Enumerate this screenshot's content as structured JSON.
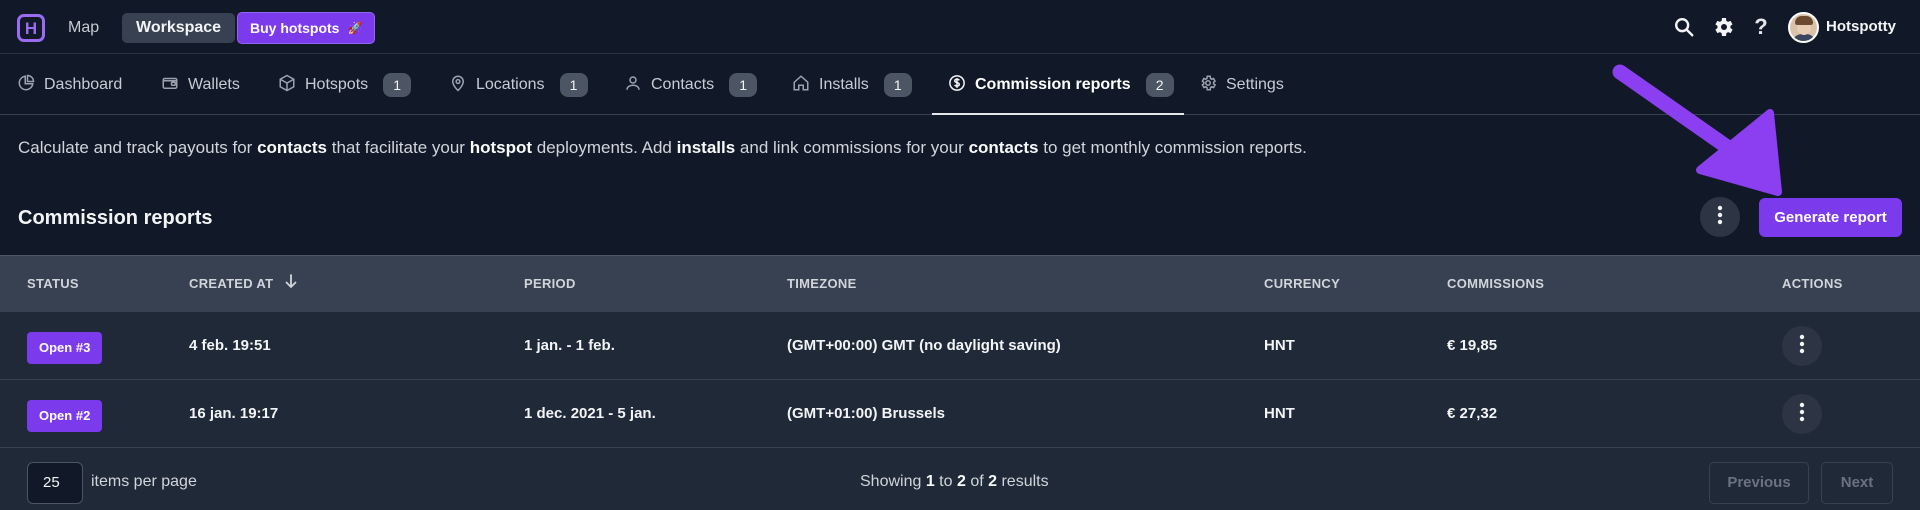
{
  "topbar": {
    "logo_letter": "H",
    "map_label": "Map",
    "workspace_label": "Workspace",
    "buy_label": "Buy hotspots",
    "buy_emoji": "🚀",
    "help_label": "?",
    "username": "Hotspotty",
    "icons": [
      "search-icon",
      "gear-icon",
      "help-icon"
    ]
  },
  "tabs": [
    {
      "label": "Dashboard",
      "icon": "pie-chart-icon",
      "count": null
    },
    {
      "label": "Wallets",
      "icon": "wallet-icon",
      "count": null
    },
    {
      "label": "Hotspots",
      "icon": "cube-icon",
      "count": "1"
    },
    {
      "label": "Locations",
      "icon": "map-pin-icon",
      "count": "1"
    },
    {
      "label": "Contacts",
      "icon": "user-icon",
      "count": "1"
    },
    {
      "label": "Installs",
      "icon": "home-icon",
      "count": "1"
    },
    {
      "label": "Commission reports",
      "icon": "dollar-circle-icon",
      "count": "2",
      "active": true
    },
    {
      "label": "Settings",
      "icon": "gear-icon",
      "count": null
    }
  ],
  "description": {
    "p1": "Calculate and track payouts for ",
    "b1": "contacts",
    "p2": " that facilitate your ",
    "b2": "hotspot",
    "p3": " deployments. Add ",
    "b3": "installs",
    "p4": " and link commissions for your ",
    "b4": "contacts",
    "p5": " to get monthly commission reports."
  },
  "section": {
    "title": "Commission reports",
    "generate_label": "Generate report"
  },
  "table": {
    "columns": [
      "STATUS",
      "CREATED AT",
      "PERIOD",
      "TIMEZONE",
      "CURRENCY",
      "COMMISSIONS",
      "ACTIONS"
    ],
    "sort_column": "CREATED AT",
    "sort_direction": "descending",
    "rows": [
      {
        "status": "Open #3",
        "created_at": "4 feb. 19:51",
        "period": "1 jan. - 1 feb.",
        "timezone": "(GMT+00:00) GMT (no daylight saving)",
        "currency": "HNT",
        "commissions": "€ 19,85"
      },
      {
        "status": "Open #2",
        "created_at": "16 jan. 19:17",
        "period": "1 dec. 2021 - 5 jan.",
        "timezone": "(GMT+01:00) Brussels",
        "currency": "HNT",
        "commissions": "€ 27,32"
      }
    ]
  },
  "footer": {
    "per_page_value": "25",
    "per_page_label": "items per page",
    "showing_prefix": "Showing ",
    "showing_from": "1",
    "showing_to_word": " to ",
    "showing_to": "2",
    "showing_of_word": " of ",
    "showing_total": "2",
    "showing_suffix": " results",
    "previous_label": "Previous",
    "next_label": "Next"
  },
  "colors": {
    "background": "#111827",
    "accent": "#7c3aed",
    "arrow_annotation": "#8b3ff0"
  }
}
